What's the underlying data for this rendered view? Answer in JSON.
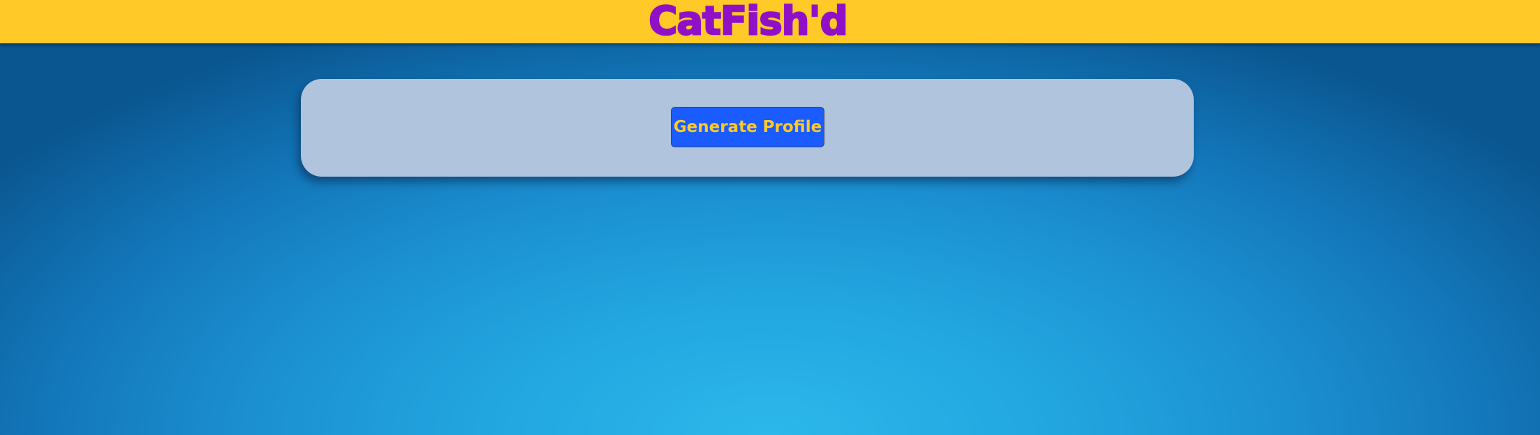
{
  "header": {
    "title": "CatFish'd"
  },
  "main": {
    "generate_button_label": "Generate Profile"
  },
  "colors": {
    "header_background": "#ffc928",
    "title_color": "#9010c8",
    "panel_background": "#b0c4de",
    "button_background": "#1a5cff",
    "button_text": "#ffc928",
    "page_background_light": "#2cb8ea",
    "page_background_dark": "#0a5690"
  }
}
